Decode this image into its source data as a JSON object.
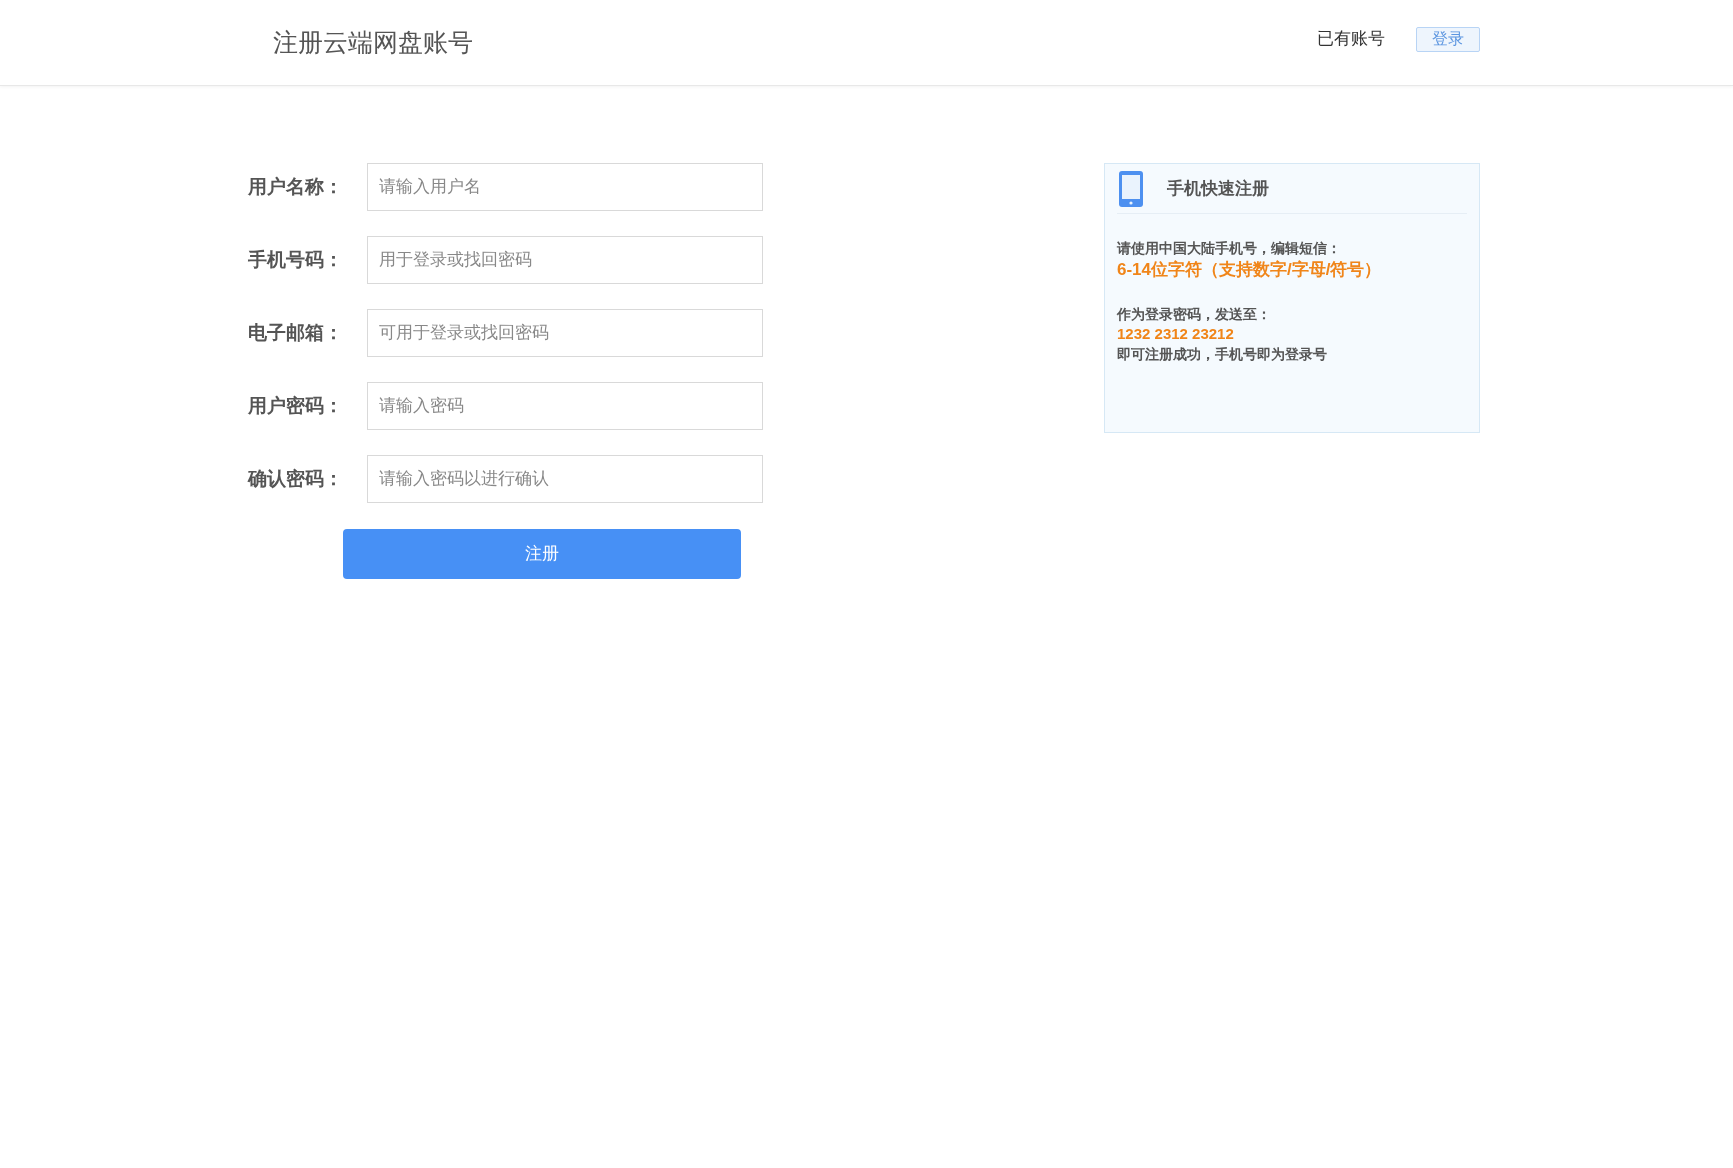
{
  "header": {
    "title": "注册云端网盘账号",
    "account_prompt": "已有账号",
    "login_button": "登录"
  },
  "form": {
    "fields": [
      {
        "label": "用户名称：",
        "placeholder": "请输入用户名"
      },
      {
        "label": "手机号码：",
        "placeholder": "用于登录或找回密码"
      },
      {
        "label": "电子邮箱：",
        "placeholder": "可用于登录或找回密码"
      },
      {
        "label": "用户密码：",
        "placeholder": "请输入密码"
      },
      {
        "label": "确认密码：",
        "placeholder": "请输入密码以进行确认"
      }
    ],
    "submit_button": "注册"
  },
  "sms_panel": {
    "title": "手机快速注册",
    "groups": [
      [
        {
          "kind": "text",
          "text": "请使用中国大陆手机号，编辑短信："
        },
        {
          "kind": "highlight-large",
          "text": "6-14位字符（支持数字/字母/符号）"
        }
      ],
      [
        {
          "kind": "text",
          "text": "作为登录密码，发送至："
        },
        {
          "kind": "highlight",
          "text": "1232 2312 23212"
        },
        {
          "kind": "text",
          "text": "即可注册成功，手机号即为登录号"
        }
      ]
    ]
  }
}
